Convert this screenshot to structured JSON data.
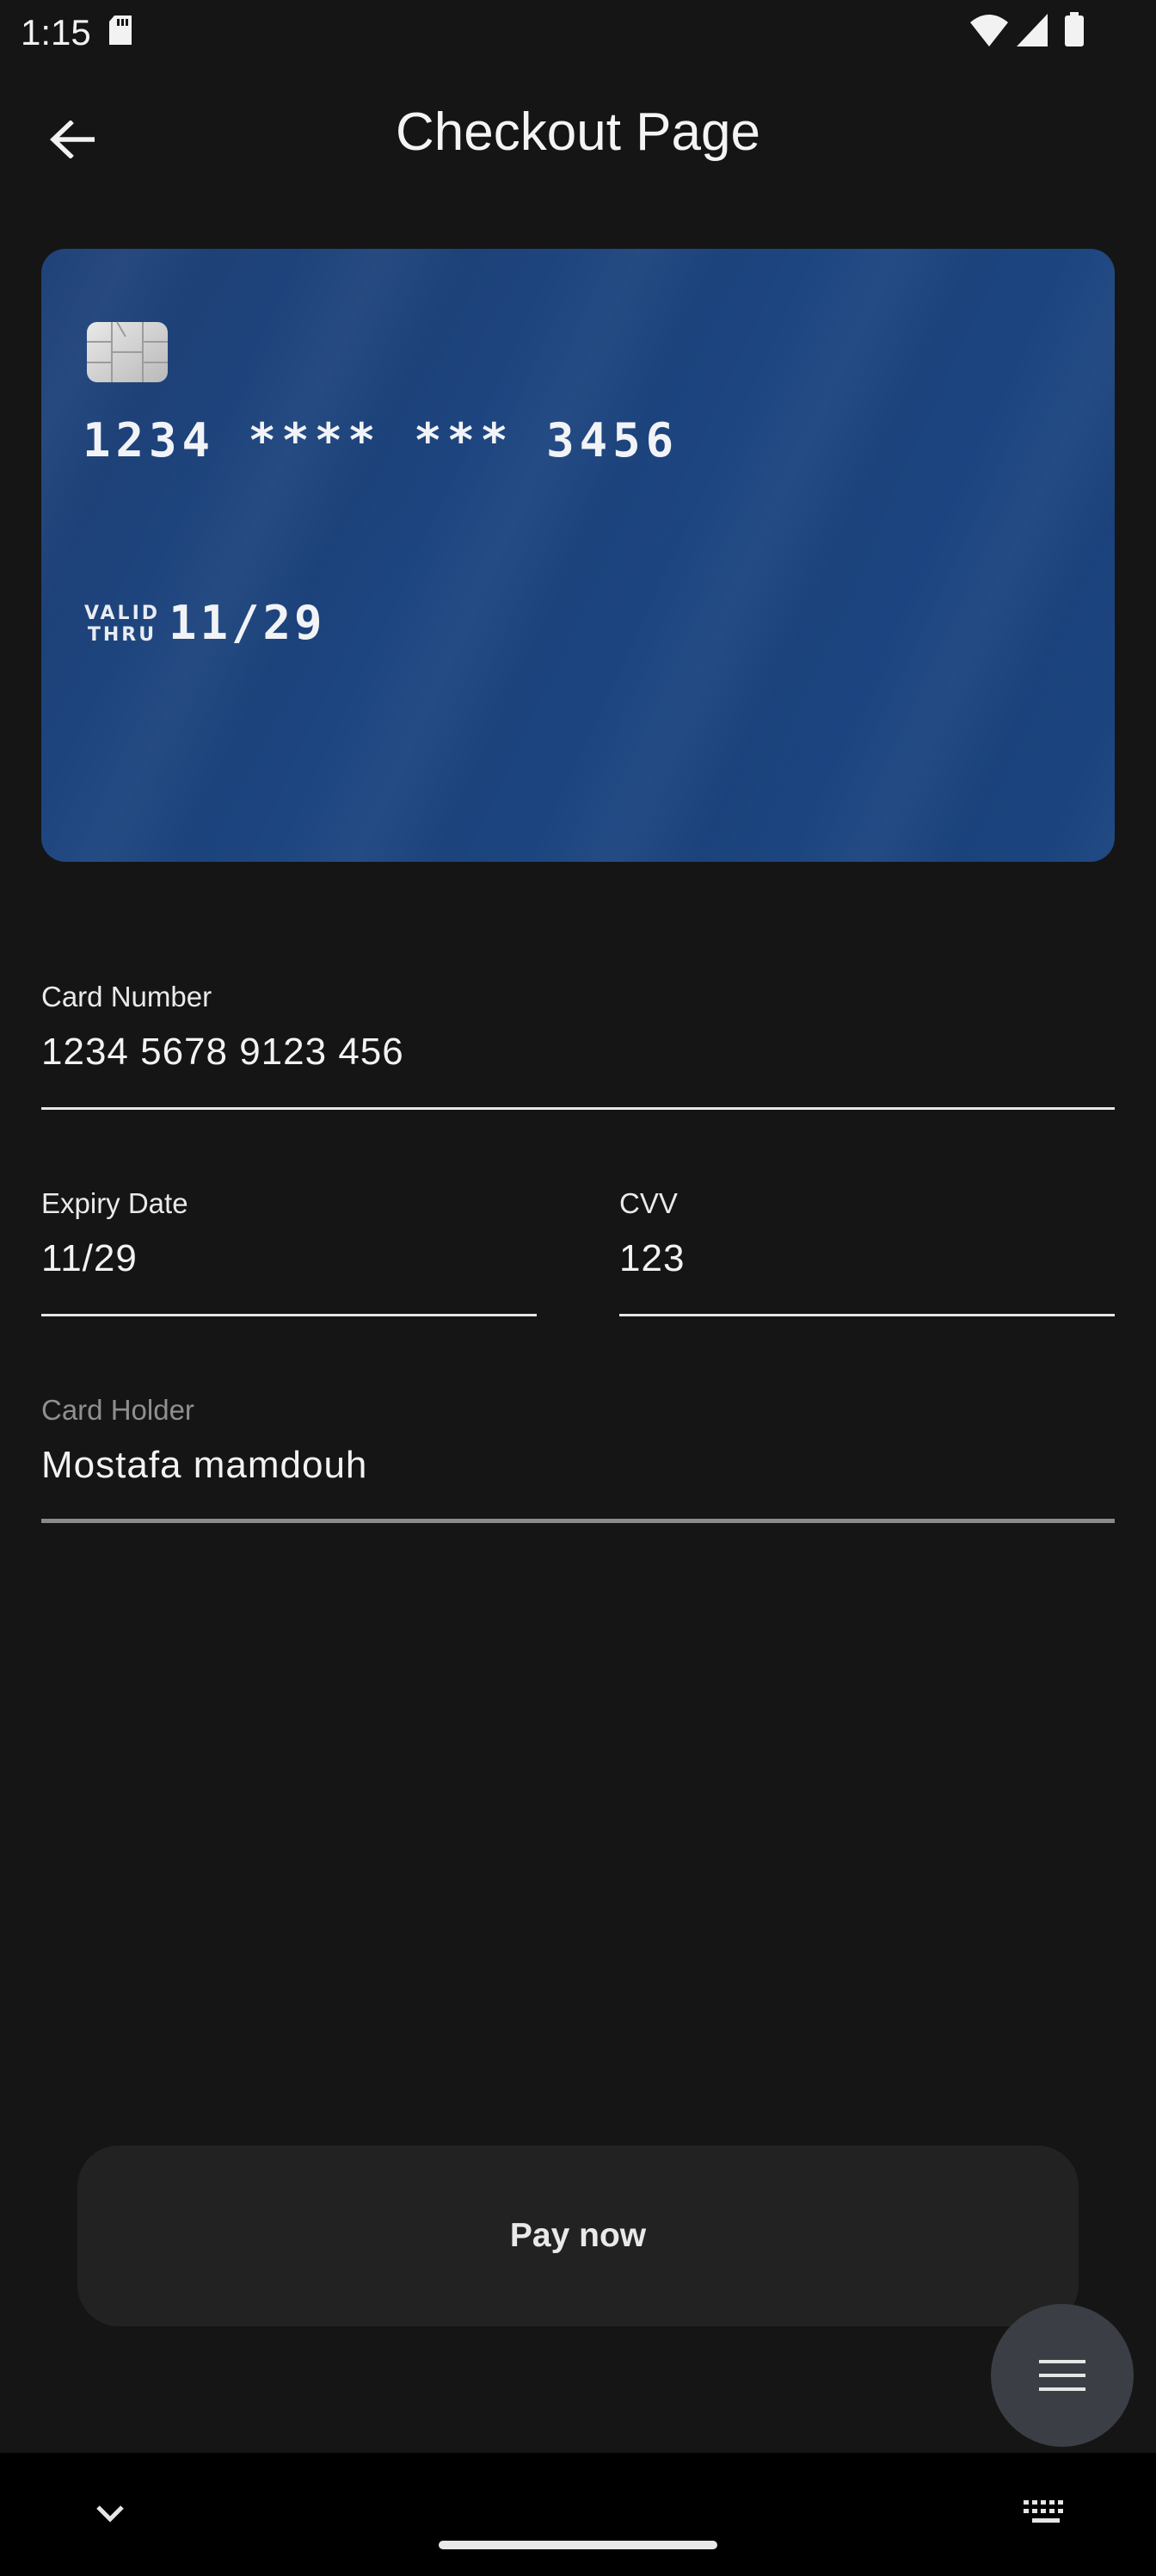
{
  "status_bar": {
    "time": "1:15",
    "icons": [
      "sd-card-icon",
      "wifi-icon",
      "signal-icon",
      "battery-icon"
    ]
  },
  "app_bar": {
    "back_icon": "arrow-left-icon",
    "title": "Checkout Page"
  },
  "card": {
    "number_masked": "1234 **** *** 3456",
    "valid_thru_label_line1": "VALID",
    "valid_thru_label_line2": "THRU",
    "expiry": "11/29",
    "background_color": "#1d4580",
    "chip_icon": "card-chip-icon"
  },
  "form": {
    "card_number": {
      "label": "Card Number",
      "value": "1234 5678 9123 456"
    },
    "expiry_date": {
      "label": "Expiry Date",
      "value": "11/29"
    },
    "cvv": {
      "label": "CVV",
      "value": "123"
    },
    "card_holder": {
      "label": "Card Holder",
      "value": "Mostafa mamdouh"
    }
  },
  "pay_button": {
    "label": "Pay now"
  },
  "fab": {
    "icon": "menu-icon"
  },
  "nav_bar": {
    "icons": [
      "chevron-down-icon",
      "keyboard-icon"
    ]
  }
}
